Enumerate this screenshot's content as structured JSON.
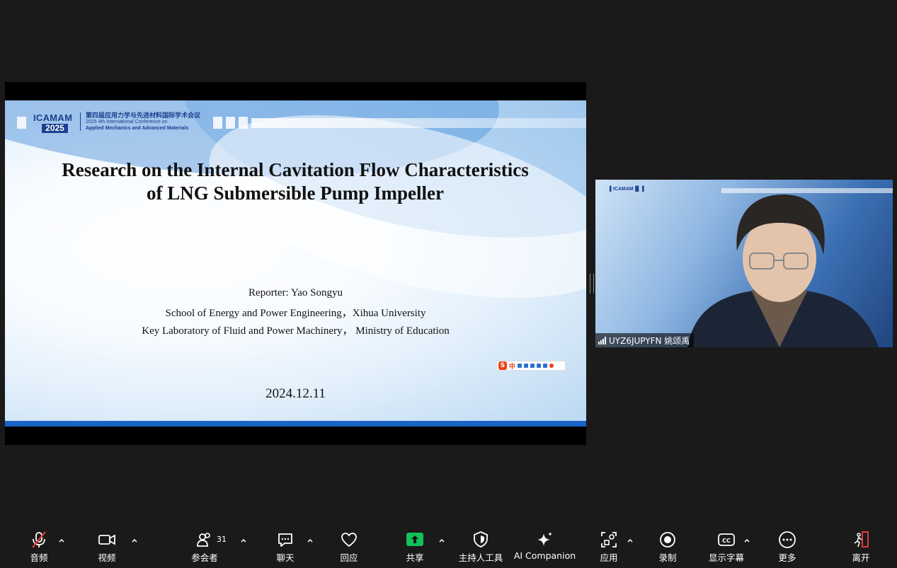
{
  "slide": {
    "logo_main": "ICAMAM",
    "logo_year": "2025",
    "conf_cn": "第四届应用力学与先进材料国际学术会议",
    "conf_en1": "2025 4th International Conference on",
    "conf_en2": "Applied Mechanics and Advanced Materials",
    "title": "Research on the Internal Cavitation Flow Characteristics of LNG Submersible Pump Impeller",
    "reporter": "Reporter: Yao Songyu",
    "school": "School of Energy and Power Engineering，Xihua University",
    "lab": "Key Laboratory of Fluid and Power Machinery，  Ministry of Education",
    "date": "2024.12.11",
    "ime_label": "中"
  },
  "video": {
    "participant_name": "UYZ6JUPYFN 姚颂禹"
  },
  "toolbar": {
    "audio": "音频",
    "video": "视频",
    "participants": "参会者",
    "participants_count": "31",
    "chat": "聊天",
    "react": "回应",
    "share": "共享",
    "host_tools": "主持人工具",
    "ai_companion": "AI Companion",
    "apps": "应用",
    "record": "录制",
    "captions": "显示字幕",
    "more": "更多",
    "leave": "离开"
  },
  "colors": {
    "share_green": "#12c15a",
    "leave_red": "#e0393e",
    "slide_blue": "#1a63c7"
  }
}
